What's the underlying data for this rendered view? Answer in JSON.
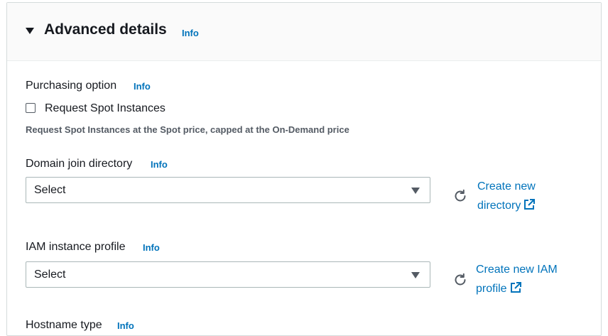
{
  "section": {
    "title": "Advanced details",
    "info_label": "Info"
  },
  "purchasing": {
    "label": "Purchasing option",
    "info_label": "Info",
    "checkbox_label": "Request Spot Instances",
    "checked": false,
    "description": "Request Spot Instances at the Spot price, capped at the On-Demand price"
  },
  "domain_join": {
    "label": "Domain join directory",
    "info_label": "Info",
    "select_value": "Select",
    "link_line1": "Create new",
    "link_line2": "directory"
  },
  "iam_profile": {
    "label": "IAM instance profile",
    "info_label": "Info",
    "select_value": "Select",
    "link_line1": "Create new IAM",
    "link_line2": "profile"
  },
  "hostname": {
    "label": "Hostname type",
    "info_label": "Info"
  },
  "icons": {
    "expand": "caret-down-icon",
    "refresh": "refresh-icon",
    "external": "external-link-icon",
    "dropdown": "dropdown-caret-icon"
  },
  "colors": {
    "link": "#0073bb",
    "text": "#16191f",
    "header_bg": "#fafafa",
    "border": "#aab7b8"
  }
}
